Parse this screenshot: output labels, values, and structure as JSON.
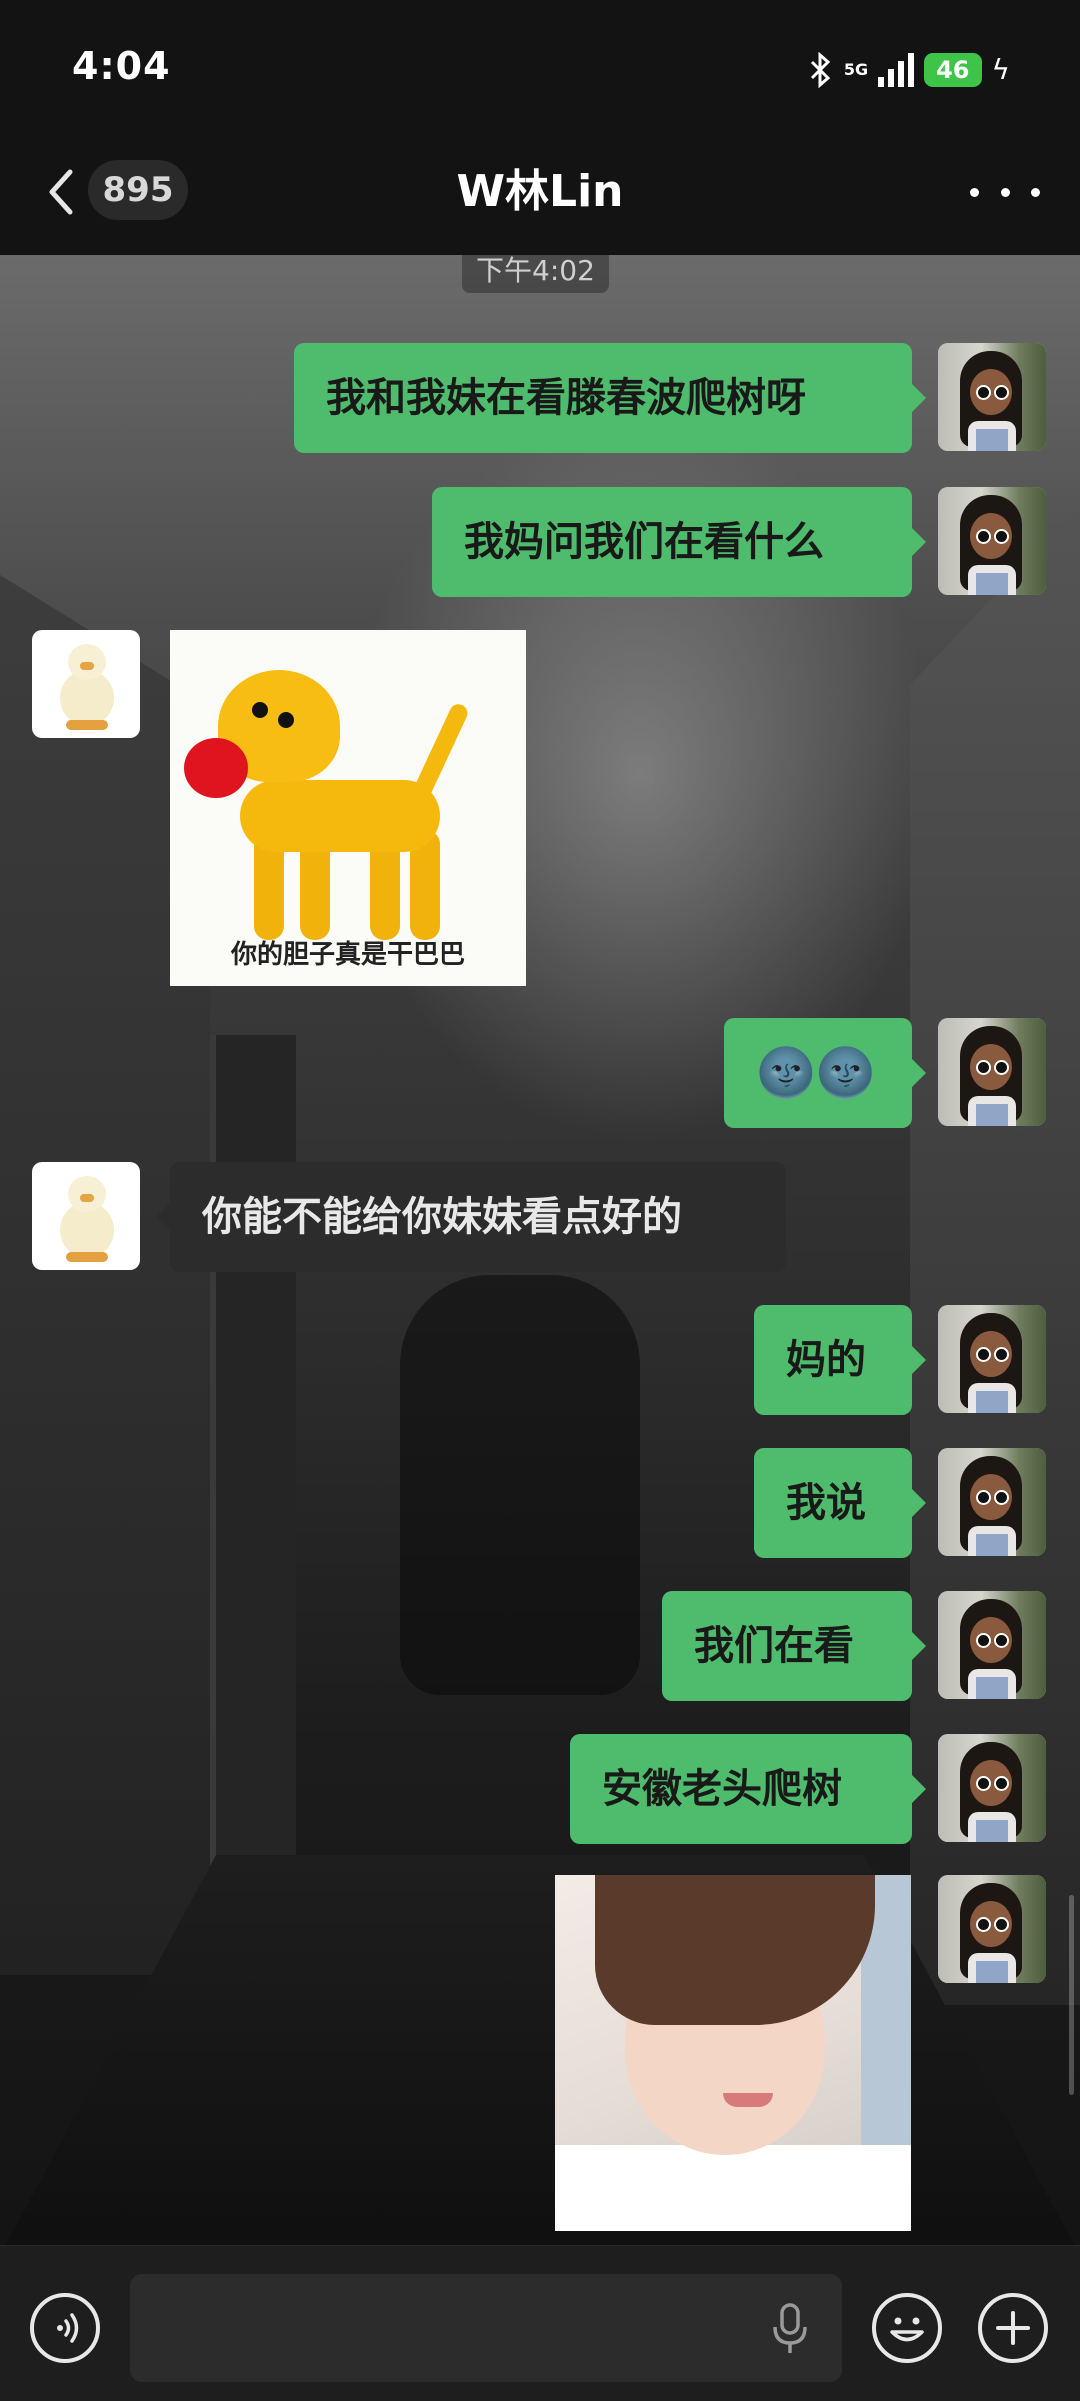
{
  "status_bar": {
    "time": "4:04",
    "network": "5G",
    "battery": "46",
    "icons": [
      "bluetooth-icon",
      "signal-icon",
      "battery-icon",
      "charging-icon"
    ]
  },
  "nav": {
    "back_icon": "chevron-left-icon",
    "unread_count": "895",
    "title": "W林Lin",
    "more_icon": "ellipsis-icon"
  },
  "chat": {
    "timestamp": "下午4:02",
    "messages": [
      {
        "from": "me",
        "type": "text",
        "text": "我和我妹在看滕春波爬树呀"
      },
      {
        "from": "me",
        "type": "text",
        "text": "我妈问我们在看什么"
      },
      {
        "from": "them",
        "type": "sticker",
        "caption": "你的胆子真是干巴巴"
      },
      {
        "from": "me",
        "type": "text",
        "text": "🌚🌚"
      },
      {
        "from": "them",
        "type": "text",
        "text": "你能不能给你妹妹看点好的"
      },
      {
        "from": "me",
        "type": "text",
        "text": "妈的"
      },
      {
        "from": "me",
        "type": "text",
        "text": "我说"
      },
      {
        "from": "me",
        "type": "text",
        "text": "我们在看"
      },
      {
        "from": "me",
        "type": "text",
        "text": "安徽老头爬树"
      },
      {
        "from": "me",
        "type": "image",
        "description": "photo"
      }
    ]
  },
  "input_bar": {
    "voice_icon": "voice-icon",
    "mic_icon": "microphone-icon",
    "emoji_icon": "emoji-icon",
    "plus_icon": "plus-icon",
    "value": ""
  },
  "colors": {
    "my_bubble": "#4ebc6c",
    "their_bubble": "#2c2c2c",
    "bar": "#131313",
    "battery": "#3ec448"
  }
}
